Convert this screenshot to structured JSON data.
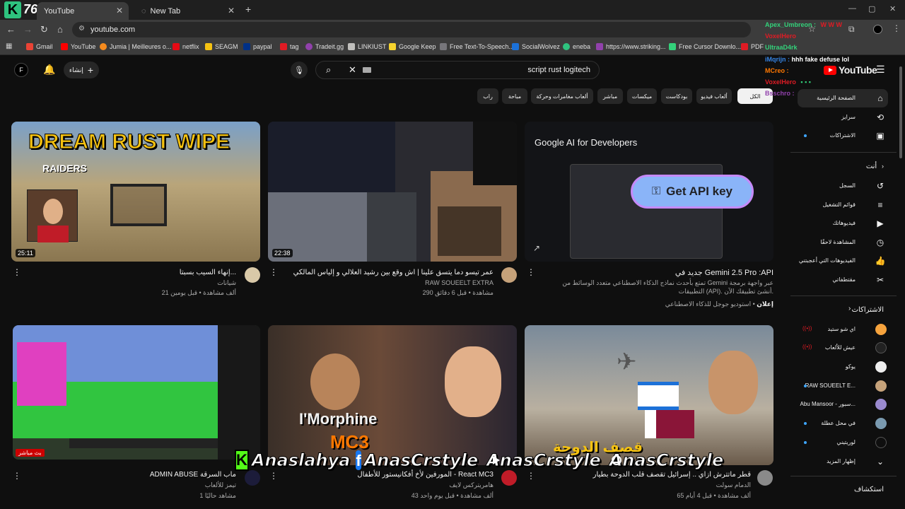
{
  "browser": {
    "tabs": [
      {
        "label": "YouTube",
        "active": true
      },
      {
        "label": "New Tab",
        "active": false
      }
    ],
    "url": "youtube.com",
    "bookmarks": [
      "Gmail",
      "YouTube",
      "Jumia | Meilleures o...",
      "netflix",
      "SEAGM",
      "paypal",
      "tag",
      "Tradeit.gg",
      "LINKIUST",
      "Google Keep",
      "Free Text-To-Speech...",
      "SocialWolvez",
      "eneba",
      "https://www.striking...",
      "Free Cursor Downlo...",
      "PDF"
    ]
  },
  "overlay": {
    "logo_text": "76",
    "chat": [
      {
        "user": "Apex_Umbreon :",
        "msg": "",
        "color": "#33d17a"
      },
      {
        "user": "VoxelHero",
        "msg": "",
        "color": "#e01b24"
      },
      {
        "user": "UltraaD4rk",
        "msg": "",
        "color": "#33d17a"
      },
      {
        "user": "iMqrijn :",
        "msg": "hhh fake defuse lol",
        "color": "#3584e4"
      },
      {
        "user": "MCreo :",
        "msg": "",
        "color": "#ff7800"
      },
      {
        "user": "VoxelHero",
        "msg": "",
        "color": "#e01b24"
      },
      {
        "user": "Bsschro :",
        "msg": "",
        "color": "#9141ac"
      }
    ],
    "socials": [
      "Anaslahya",
      "AnasCrstyle",
      "AnasCrstyle",
      "AnasCrstyle"
    ]
  },
  "youtube": {
    "brand": "YouTube",
    "create_label": "إنشاء",
    "account_initial": "F",
    "search_value": "script rust logitech",
    "chips": [
      "الكل",
      "ألعاب فيديو",
      "بودكاست",
      "ميكسات",
      "مباشر",
      "ألعاب مغامرات وحركة",
      "مباحة",
      "راب"
    ],
    "sidebar": {
      "main": [
        "الصفحة الرئيسية",
        "سرايز",
        "الاشتراكات"
      ],
      "you_header": "أنت",
      "you": [
        "السجل",
        "قوائم التشغيل",
        "فيديوهاتك",
        "المشاهدة لاحقًا",
        "الفيديوهات التي أعجبتني",
        "مقتطفاتي"
      ],
      "subs_header": "الاشتراكات",
      "subs": [
        "اي شو ستيد",
        "عيش للألعاب",
        "يوكو",
        "RAW SOUEELT E...",
        "Abu Mansoor - سبور...",
        "في محل عطلة",
        "لوريتيني"
      ],
      "show_more": "إظهار المزيد",
      "explore": "استكشاف"
    },
    "videos": [
      {
        "title": "إنهاء السيب بسبتا...",
        "channel": "شيانات",
        "meta": "21 ألف مشاهدة • قبل يومين",
        "duration": "25:11",
        "thumb_text": "DREAM RUST WIPE",
        "thumb_sub": "RAIDERS"
      },
      {
        "title": "عمر تيسو دما يتسق علينا | اش وقع بين رشيد العلالي و إلياس المالكي",
        "channel": "RAW SOUEELT EXTRA",
        "meta": "290 مشاهدة • قبل 6 دقائق",
        "duration": "22:38"
      },
      {
        "title": "جديد في Gemini 2.5 Pro :API",
        "channel": "استوديو جوجل للذكاء الاصطناعي",
        "meta": "تمتع بأحدث نماذج الذكاء الاصطناعي متعدد الوسائط من Gemini عبر واجهة برمجة التطبيقات (API). أنشئ تطبيقك الآن.",
        "ad_label": "إعلان",
        "thumb_brand": "Google AI for Developers",
        "thumb_cta": "Get API key"
      },
      {
        "title": "ADMIN ABUSE ماب السرقة",
        "channel": "تيمز للألعاب",
        "meta": "1 مشاهد حاليًا",
        "live_badge": "بث مباشر"
      },
      {
        "title": "المورفين لأخ أفكانيستور للأطفال - React MC3",
        "channel": "هامريتركس لايف",
        "meta": "43 ألف مشاهدة • قبل يوم واحد",
        "thumb_text": "I'Morphine",
        "thumb_sub": "MC3"
      },
      {
        "title": "قطر ماتترش ازاي .. إسرائيل تقصف قلب الدوحة بطيار",
        "channel": "الدمام سولت",
        "meta": "65 ألف مشاهدة • قبل 4 أيام",
        "thumb_text": "قصف الدوحة"
      }
    ]
  }
}
